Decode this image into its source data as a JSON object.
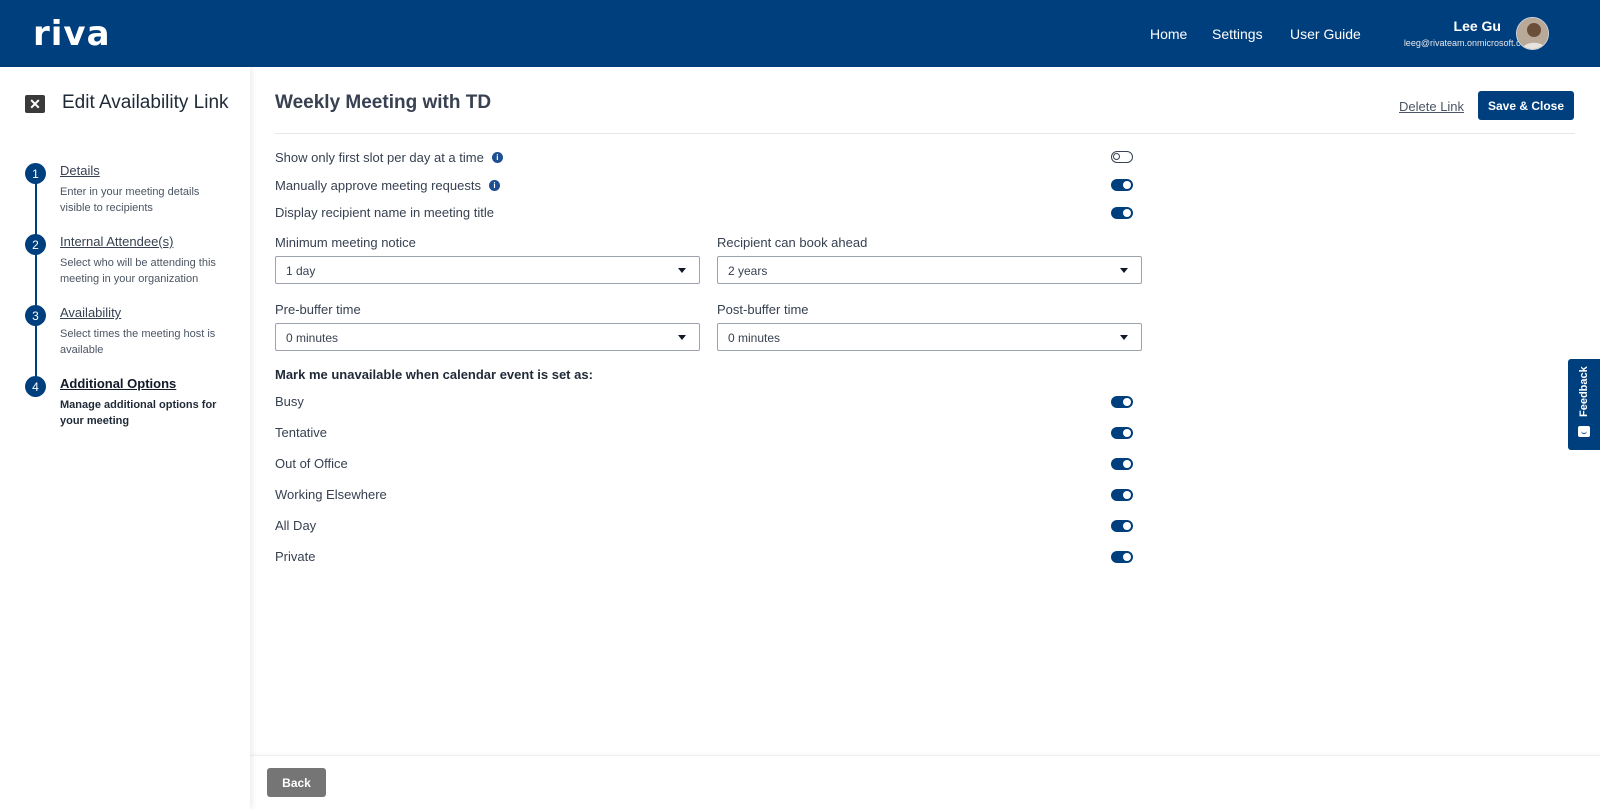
{
  "header": {
    "logo": "riva",
    "nav": [
      "Home",
      "Settings",
      "User Guide"
    ],
    "user": {
      "name": "Lee Gu",
      "email": "leeg@rivateam.onmicrosoft.com"
    },
    "background_color": "#003f7d"
  },
  "sidebar": {
    "title": "Edit Availability Link",
    "steps": [
      {
        "number": "1",
        "title": "Details",
        "description": "Enter in your meeting details visible to recipients"
      },
      {
        "number": "2",
        "title": "Internal Attendee(s)",
        "description": "Select who will be attending this meeting in your organization"
      },
      {
        "number": "3",
        "title": "Availability",
        "description": "Select times the meeting host is available"
      },
      {
        "number": "4",
        "title": "Additional Options",
        "description": "Manage additional options for your meeting",
        "active": true
      }
    ]
  },
  "main": {
    "title": "Weekly Meeting with TD",
    "delete_label": "Delete Link",
    "save_label": "Save & Close",
    "options": [
      {
        "label": "Show only first slot per day at a time",
        "info": true,
        "enabled": false
      },
      {
        "label": "Manually approve meeting requests",
        "info": true,
        "enabled": true
      },
      {
        "label": "Display recipient name in meeting title",
        "info": false,
        "enabled": true
      }
    ],
    "fields": {
      "min_notice": {
        "label": "Minimum meeting notice",
        "value": "1 day"
      },
      "book_ahead": {
        "label": "Recipient can book ahead",
        "value": "2 years"
      },
      "pre_buffer": {
        "label": "Pre-buffer time",
        "value": "0 minutes"
      },
      "post_buffer": {
        "label": "Post-buffer time",
        "value": "0 minutes"
      }
    },
    "unavailable_heading": "Mark me unavailable when calendar event is set as:",
    "unavailable_statuses": [
      {
        "label": "Busy",
        "enabled": true
      },
      {
        "label": "Tentative",
        "enabled": true
      },
      {
        "label": "Out of Office",
        "enabled": true
      },
      {
        "label": "Working Elsewhere",
        "enabled": true
      },
      {
        "label": "All Day",
        "enabled": true
      },
      {
        "label": "Private",
        "enabled": true
      }
    ]
  },
  "feedback": {
    "label": "Feedback",
    "icon": "feedback-icon"
  },
  "footer": {
    "back_label": "Back"
  },
  "colors": {
    "accent": "#003f7d",
    "back_button": "#757575"
  }
}
